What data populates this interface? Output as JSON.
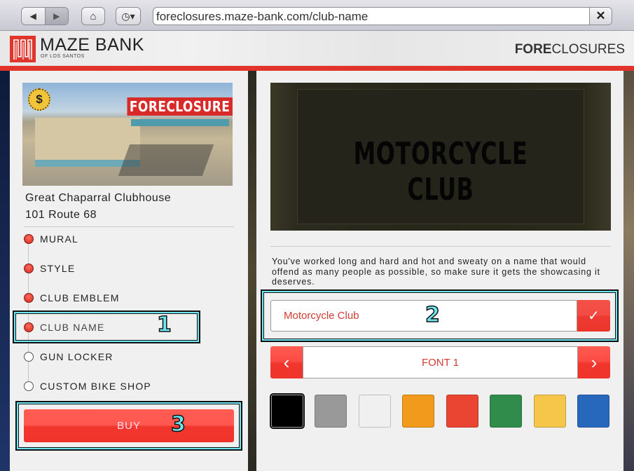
{
  "browser": {
    "back_icon": "back-arrow-icon",
    "forward_icon": "forward-arrow-icon",
    "home_icon": "home-icon",
    "history_icon": "clock-dropdown-icon",
    "url": "foreclosures.maze-bank.com/club-name",
    "close_icon": "close-x-icon",
    "glyphs": {
      "back": "◀",
      "forward": "▶",
      "home": "⌂",
      "history": "◷▾",
      "close": "✕"
    }
  },
  "header": {
    "logo_name": "MAZE BANK",
    "logo_sub": "OF LOS SANTOS",
    "section_bold": "FORE",
    "section_rest": "CLOSURES",
    "accent_color": "#e3342b"
  },
  "property": {
    "stamp": "FORECLOSURE",
    "badge": "$",
    "name": "Great Chaparral Clubhouse",
    "address": "101 Route 68"
  },
  "steps": [
    {
      "label": "MURAL",
      "done": true
    },
    {
      "label": "STYLE",
      "done": true
    },
    {
      "label": "CLUB EMBLEM",
      "done": true
    },
    {
      "label": "CLUB NAME",
      "done": true,
      "active": true
    },
    {
      "label": "GUN LOCKER",
      "done": false
    },
    {
      "label": "CUSTOM BIKE SHOP",
      "done": false
    }
  ],
  "buy_label": "BUY",
  "annotations": [
    "1",
    "2",
    "3"
  ],
  "preview": {
    "text": "MOTORCYCLE CLUB"
  },
  "description": "You've worked long and hard and hot and sweaty on a name that would offend as many people as possible, so make sure it gets the showcasing it deserves.",
  "name_input": {
    "value": "Motorcycle Club",
    "confirm_glyph": "✓"
  },
  "font_selector": {
    "value": "FONT 1",
    "prev_glyph": "‹",
    "next_glyph": "›"
  },
  "colors": [
    {
      "name": "black",
      "hex": "#000000",
      "selected": true
    },
    {
      "name": "gray",
      "hex": "#999999"
    },
    {
      "name": "white",
      "hex": "#f0f0f0"
    },
    {
      "name": "orange",
      "hex": "#f19a1b"
    },
    {
      "name": "red",
      "hex": "#ea4532"
    },
    {
      "name": "green",
      "hex": "#2f8c4a"
    },
    {
      "name": "yellow",
      "hex": "#f5c64a"
    },
    {
      "name": "blue",
      "hex": "#2768bd"
    }
  ]
}
